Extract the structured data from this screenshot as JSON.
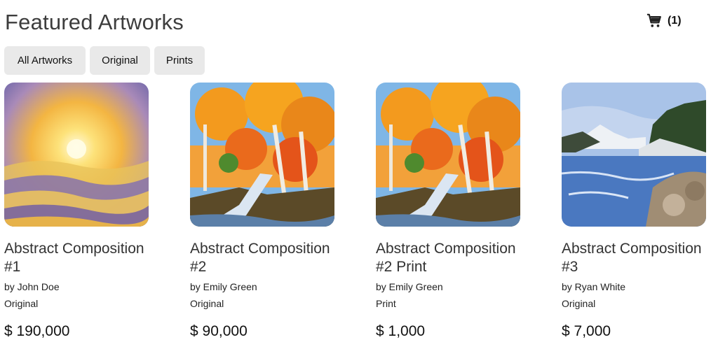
{
  "header": {
    "title": "Featured Artworks",
    "cart_count": "(1)",
    "cart_icon": "shopping-cart-icon"
  },
  "filters": [
    {
      "label": "All Artworks"
    },
    {
      "label": "Original"
    },
    {
      "label": "Prints"
    }
  ],
  "artworks": [
    {
      "title": "Abstract Composition #1",
      "artist": "by John Doe",
      "type": "Original",
      "price": "$ 190,000"
    },
    {
      "title": "Abstract Composition #2",
      "artist": "by Emily Green",
      "type": "Original",
      "price": "$ 90,000"
    },
    {
      "title": "Abstract Composition #2 Print",
      "artist": "by Emily Green",
      "type": "Print",
      "price": "$ 1,000"
    },
    {
      "title": "Abstract Composition #3",
      "artist": "by Ryan White",
      "type": "Original",
      "price": "$ 7,000"
    }
  ]
}
